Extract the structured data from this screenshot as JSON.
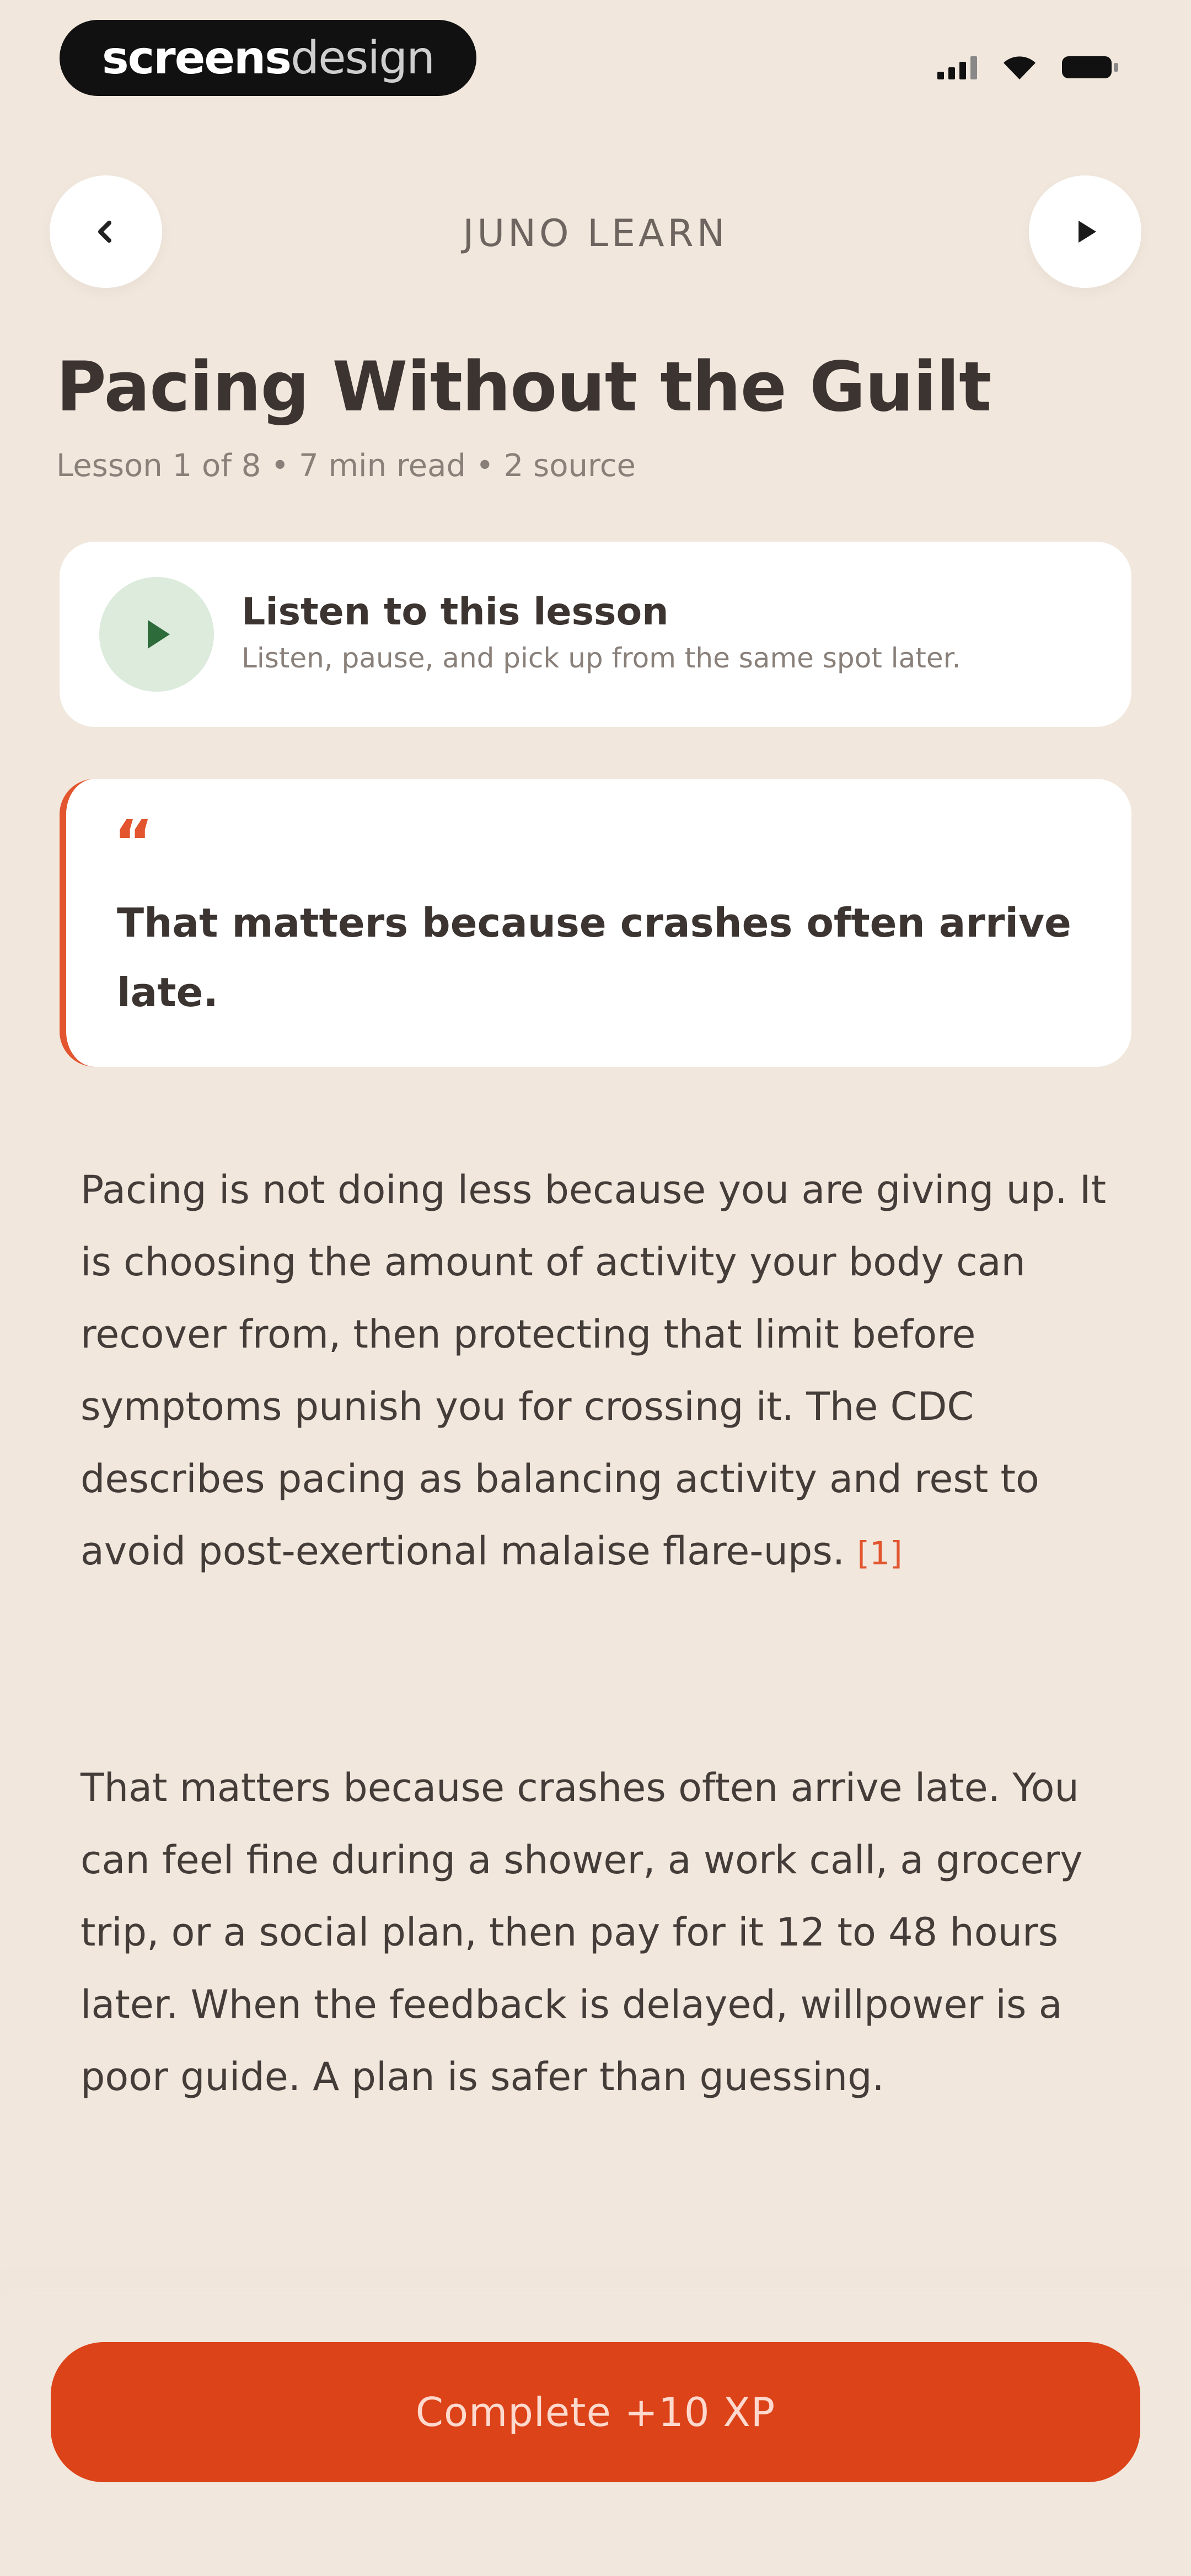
{
  "status_bar": {
    "brand_strong": "screens",
    "brand_light": "design"
  },
  "header": {
    "title": "JUNO LEARN",
    "back_icon": "chevron-left-icon",
    "play_icon": "play-icon"
  },
  "lesson": {
    "title": "Pacing Without the Guilt",
    "meta": "Lesson 1 of 8 • 7 min read • 2 source"
  },
  "audio_card": {
    "title": "Listen to this lesson",
    "subtitle": "Listen, pause, and pick up from the same spot later.",
    "icon": "play-icon",
    "accent_color": "#2e6b3a",
    "bg_color": "#dcebdc"
  },
  "quote": {
    "mark": "“",
    "text": "That matters because crashes often arrive late."
  },
  "body": {
    "p1": "Pacing is not doing less because you are giving up. It is choosing the amount of activity your body can recover from, then protecting that limit before symptoms punish you for crossing it. The CDC describes pacing as balancing activity and rest to avoid post-exertional malaise flare-ups.",
    "p1_citation": "[1]",
    "p2": "That matters because crashes often arrive late. You can feel fine during a shower, a work call, a grocery trip, or a social plan, then pay for it 12 to 48 hours later. When the feedback is delayed, willpower is a poor guide. A plan is safer than guessing.",
    "p3": ""
  },
  "footer": {
    "button_label": "Complete +10 XP",
    "button_color": "#dc4319"
  },
  "colors": {
    "background": "#f1e7dc",
    "accent": "#e2552f",
    "card": "#ffffff"
  }
}
